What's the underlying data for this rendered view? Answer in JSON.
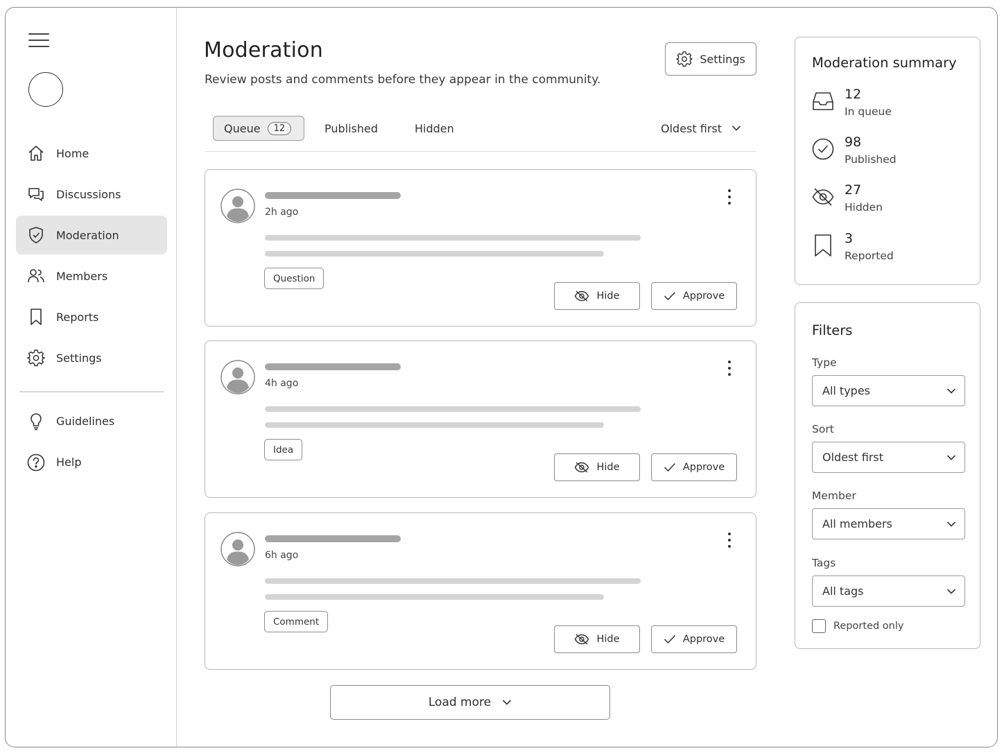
{
  "app": {
    "nav": {
      "items": [
        {
          "id": "home",
          "label": "Home",
          "icon": "home-icon"
        },
        {
          "id": "discussions",
          "label": "Discussions",
          "icon": "chat-bubbles-icon"
        },
        {
          "id": "moderation",
          "label": "Moderation",
          "icon": "shield-check-icon",
          "active": true
        },
        {
          "id": "members",
          "label": "Members",
          "icon": "users-icon"
        },
        {
          "id": "reports",
          "label": "Reports",
          "icon": "bookmark-icon"
        },
        {
          "id": "settings",
          "label": "Settings",
          "icon": "gear-icon"
        }
      ],
      "secondary": [
        {
          "id": "guidelines",
          "label": "Guidelines",
          "icon": "lightbulb-icon"
        },
        {
          "id": "help",
          "label": "Help",
          "icon": "question-circle-icon"
        }
      ]
    }
  },
  "header": {
    "title": "Moderation",
    "subtitle": "Review posts and comments before they appear in the community.",
    "settings_label": "Settings"
  },
  "tabs": {
    "items": [
      {
        "label": "Queue",
        "count": "12",
        "active": true
      },
      {
        "label": "Published"
      },
      {
        "label": "Hidden"
      }
    ],
    "sort_label": "Oldest first"
  },
  "queue": [
    {
      "time": "2h ago",
      "tag": "Question",
      "hide_label": "Hide",
      "approve_label": "Approve"
    },
    {
      "time": "4h ago",
      "tag": "Idea",
      "hide_label": "Hide",
      "approve_label": "Approve"
    },
    {
      "time": "6h ago",
      "tag": "Comment",
      "hide_label": "Hide",
      "approve_label": "Approve"
    }
  ],
  "load_more_label": "Load more",
  "summary": {
    "title": "Moderation summary",
    "stats": [
      {
        "value": "12",
        "label": "In queue",
        "icon": "inbox-icon"
      },
      {
        "value": "98",
        "label": "Published",
        "icon": "check-circle-icon"
      },
      {
        "value": "27",
        "label": "Hidden",
        "icon": "eye-off-icon"
      },
      {
        "value": "3",
        "label": "Reported",
        "icon": "bookmark-icon"
      }
    ]
  },
  "filters": {
    "title": "Filters",
    "type_label": "Type",
    "type_value": "All types",
    "sort_label": "Sort",
    "sort_value": "Oldest first",
    "member_label": "Member",
    "member_value": "All members",
    "tags_label": "Tags",
    "tags_value": "All tags",
    "reported_only_label": "Reported only"
  },
  "colors": {
    "text": "#2b2b2b",
    "border": "#8a8a8a",
    "active_bg": "#e5e5e5",
    "skeleton_title": "#a5a5a5",
    "skeleton_body": "#d4d4d4"
  }
}
